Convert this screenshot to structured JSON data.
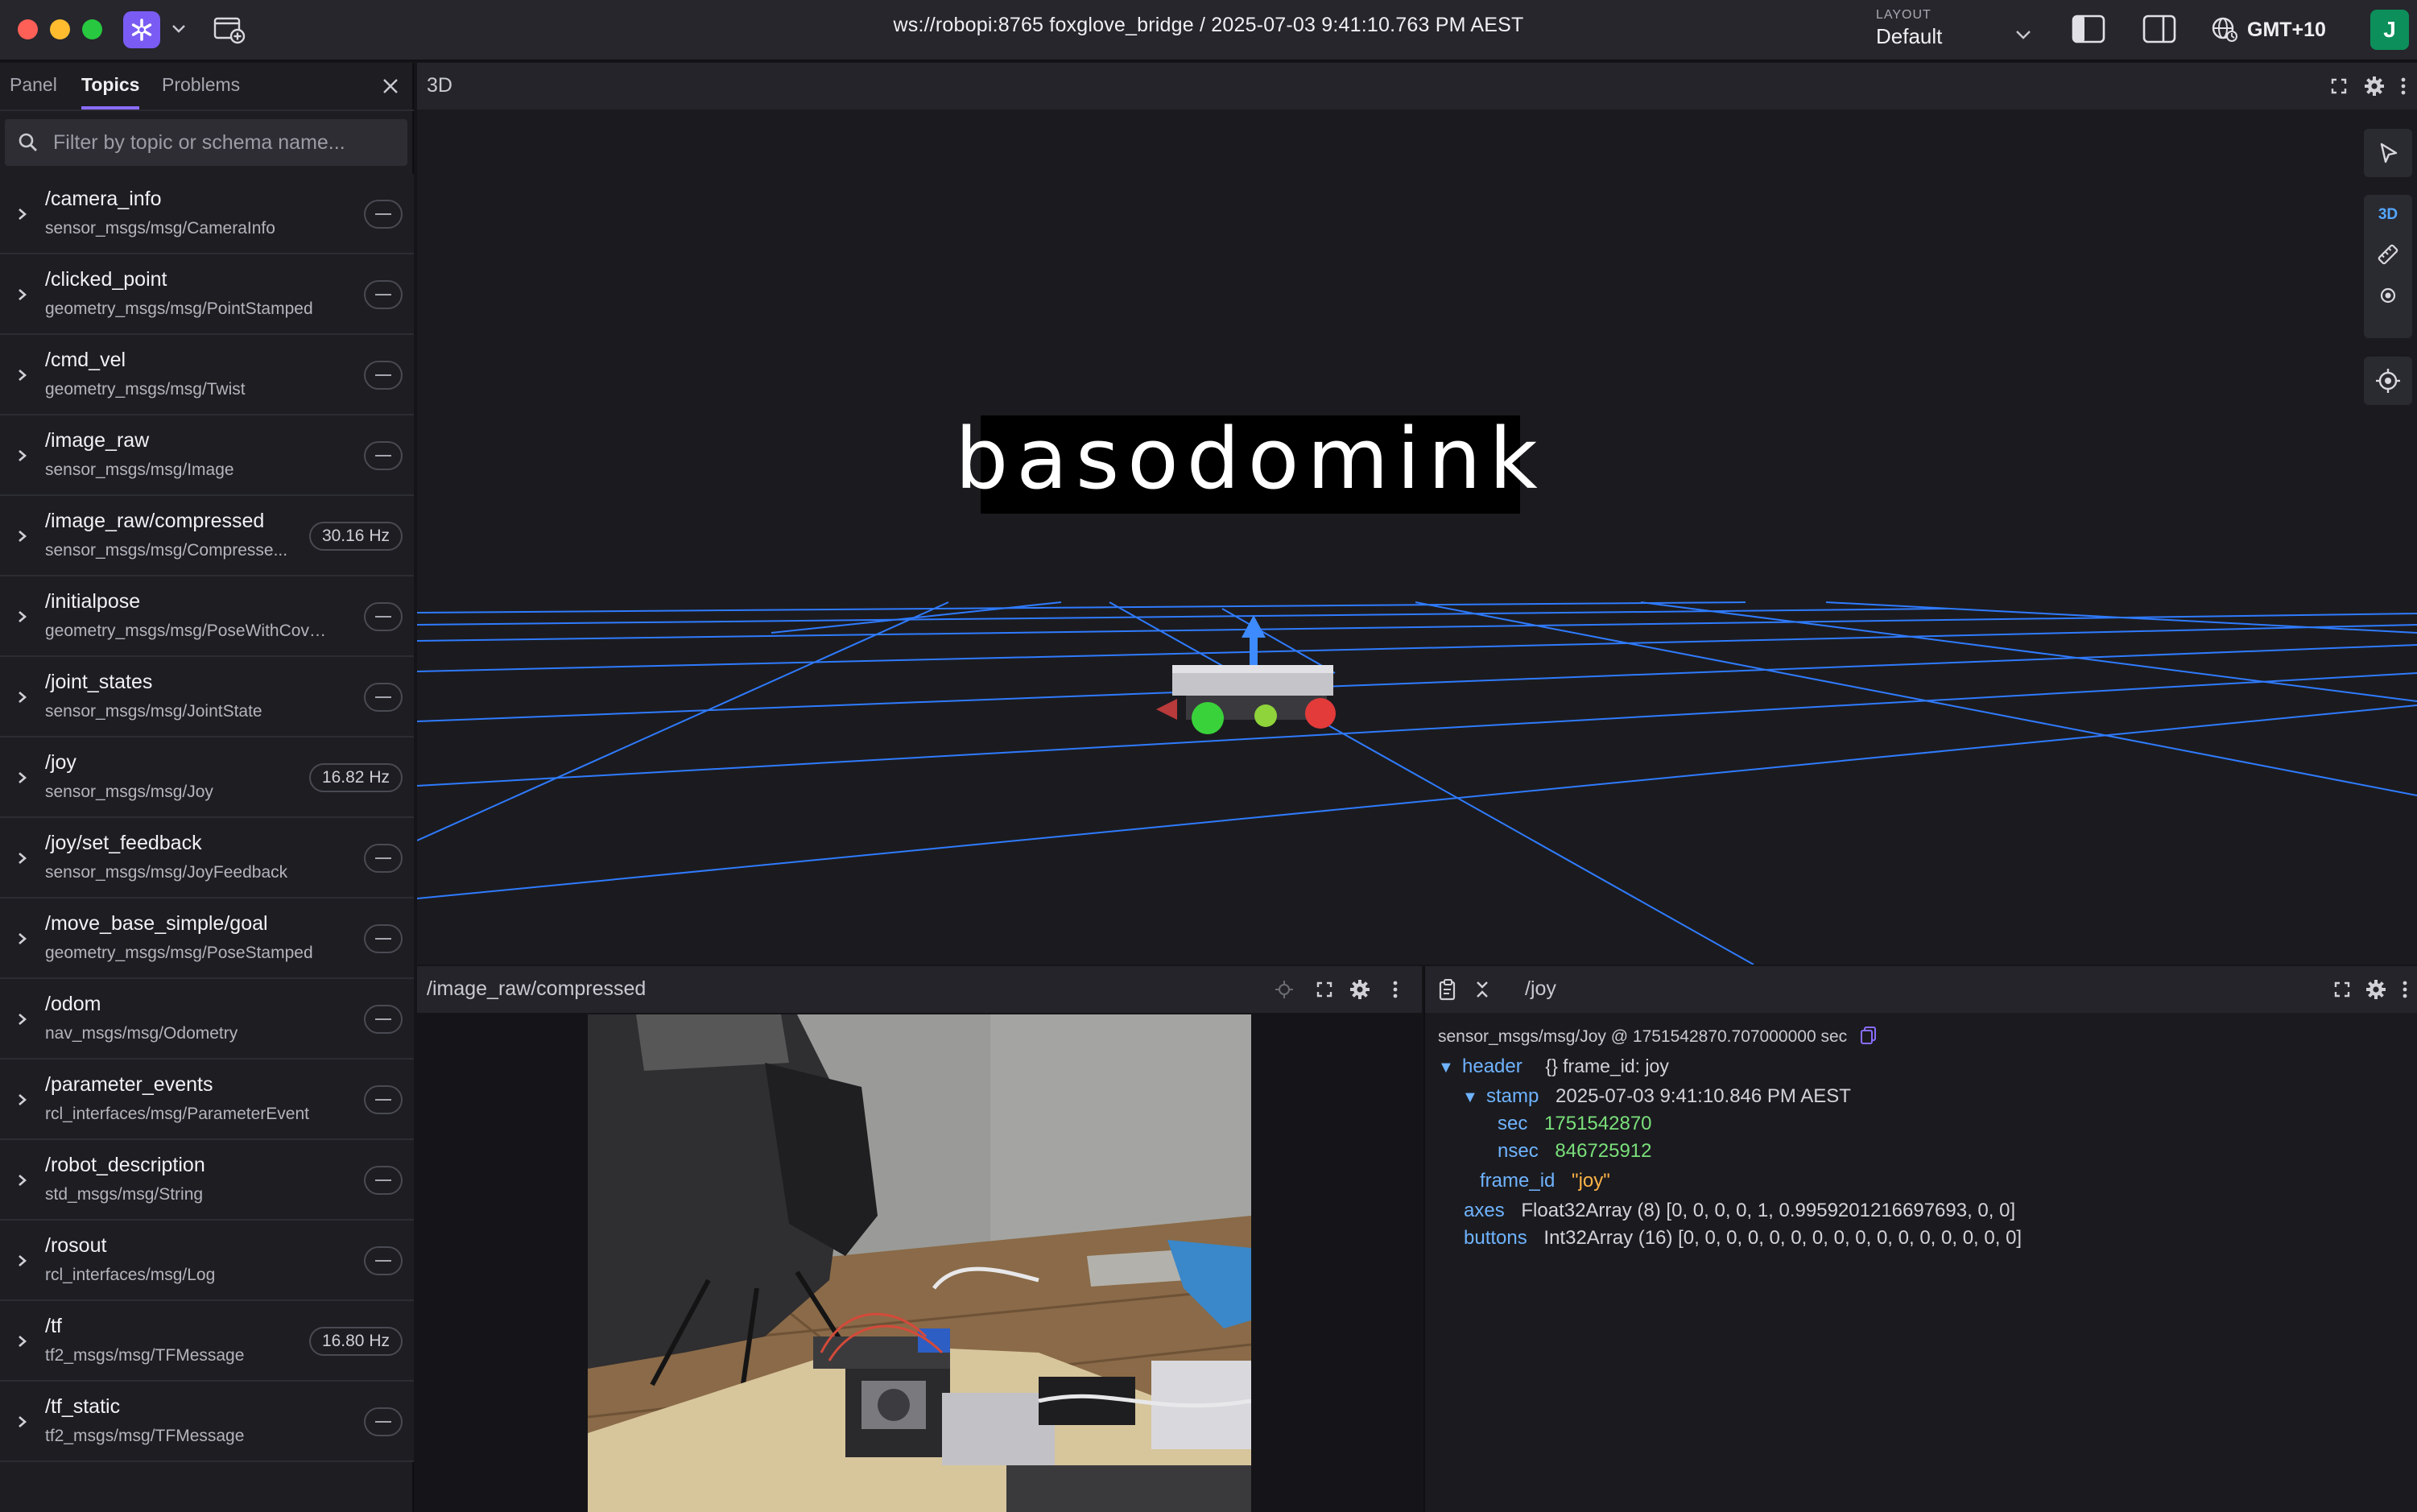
{
  "titlebar": {
    "connection_title": "ws://robopi:8765 foxglove_bridge / 2025-07-03 9:41:10.763 PM AEST",
    "layout_caption": "LAYOUT",
    "layout_value": "Default",
    "timezone": "GMT+10",
    "user_initial": "J",
    "icons": [
      "app-logo-icon",
      "chevron-down-icon",
      "new-window-icon",
      "sidebar-left-icon",
      "sidebar-right-icon",
      "globe-icon"
    ]
  },
  "sidebar": {
    "tabs": [
      {
        "label": "Panel"
      },
      {
        "label": "Topics",
        "active": true
      },
      {
        "label": "Problems"
      }
    ],
    "search_placeholder": "Filter by topic or schema name...",
    "topics": [
      {
        "name": "/camera_info",
        "schema": "sensor_msgs/msg/CameraInfo",
        "badge": ""
      },
      {
        "name": "/clicked_point",
        "schema": "geometry_msgs/msg/PointStamped",
        "badge": ""
      },
      {
        "name": "/cmd_vel",
        "schema": "geometry_msgs/msg/Twist",
        "badge": ""
      },
      {
        "name": "/image_raw",
        "schema": "sensor_msgs/msg/Image",
        "badge": ""
      },
      {
        "name": "/image_raw/compressed",
        "schema": "sensor_msgs/msg/Compresse...",
        "badge": "30.16 Hz"
      },
      {
        "name": "/initialpose",
        "schema": "geometry_msgs/msg/PoseWithCovari...",
        "badge": ""
      },
      {
        "name": "/joint_states",
        "schema": "sensor_msgs/msg/JointState",
        "badge": ""
      },
      {
        "name": "/joy",
        "schema": "sensor_msgs/msg/Joy",
        "badge": "16.82 Hz"
      },
      {
        "name": "/joy/set_feedback",
        "schema": "sensor_msgs/msg/JoyFeedback",
        "badge": ""
      },
      {
        "name": "/move_base_simple/goal",
        "schema": "geometry_msgs/msg/PoseStamped",
        "badge": ""
      },
      {
        "name": "/odom",
        "schema": "nav_msgs/msg/Odometry",
        "badge": ""
      },
      {
        "name": "/parameter_events",
        "schema": "rcl_interfaces/msg/ParameterEvent",
        "badge": ""
      },
      {
        "name": "/robot_description",
        "schema": "std_msgs/msg/String",
        "badge": ""
      },
      {
        "name": "/rosout",
        "schema": "rcl_interfaces/msg/Log",
        "badge": ""
      },
      {
        "name": "/tf",
        "schema": "tf2_msgs/msg/TFMessage",
        "badge": "16.80 Hz"
      },
      {
        "name": "/tf_static",
        "schema": "tf2_msgs/msg/TFMessage",
        "badge": ""
      }
    ]
  },
  "panel_3d": {
    "title": "3D",
    "frame_label": "basodomink",
    "tools": [
      "select-icon",
      "3D",
      "ruler-icon",
      "publish-point-icon",
      "locate-icon"
    ],
    "colors": {
      "grid": "#2f7bff",
      "axis_z": "#3d8bff",
      "axis_x": "#d83a3a",
      "sphere_green": "#3ad23a",
      "sphere_red": "#e33a3a"
    }
  },
  "panel_image": {
    "title": "/image_raw/compressed"
  },
  "panel_raw": {
    "topic": "/joy",
    "message_meta": "sensor_msgs/msg/Joy @ 1751542870.707000000 sec",
    "header_key": "header",
    "header_summary": "{} frame_id: joy",
    "stamp_key": "stamp",
    "stamp_value": "2025-07-03 9:41:10.846 PM AEST",
    "sec_key": "sec",
    "sec_value": "1751542870",
    "nsec_key": "nsec",
    "nsec_value": "846725912",
    "frame_id_key": "frame_id",
    "frame_id_value": "\"joy\"",
    "axes_key": "axes",
    "axes_value": "Float32Array (8) [0, 0, 0, 0, 1, 0.9959201216697693, 0, 0]",
    "buttons_key": "buttons",
    "buttons_value": "Int32Array (16) [0, 0, 0, 0, 0, 0, 0, 0, 0, 0, 0, 0, 0, 0, 0, 0]"
  }
}
